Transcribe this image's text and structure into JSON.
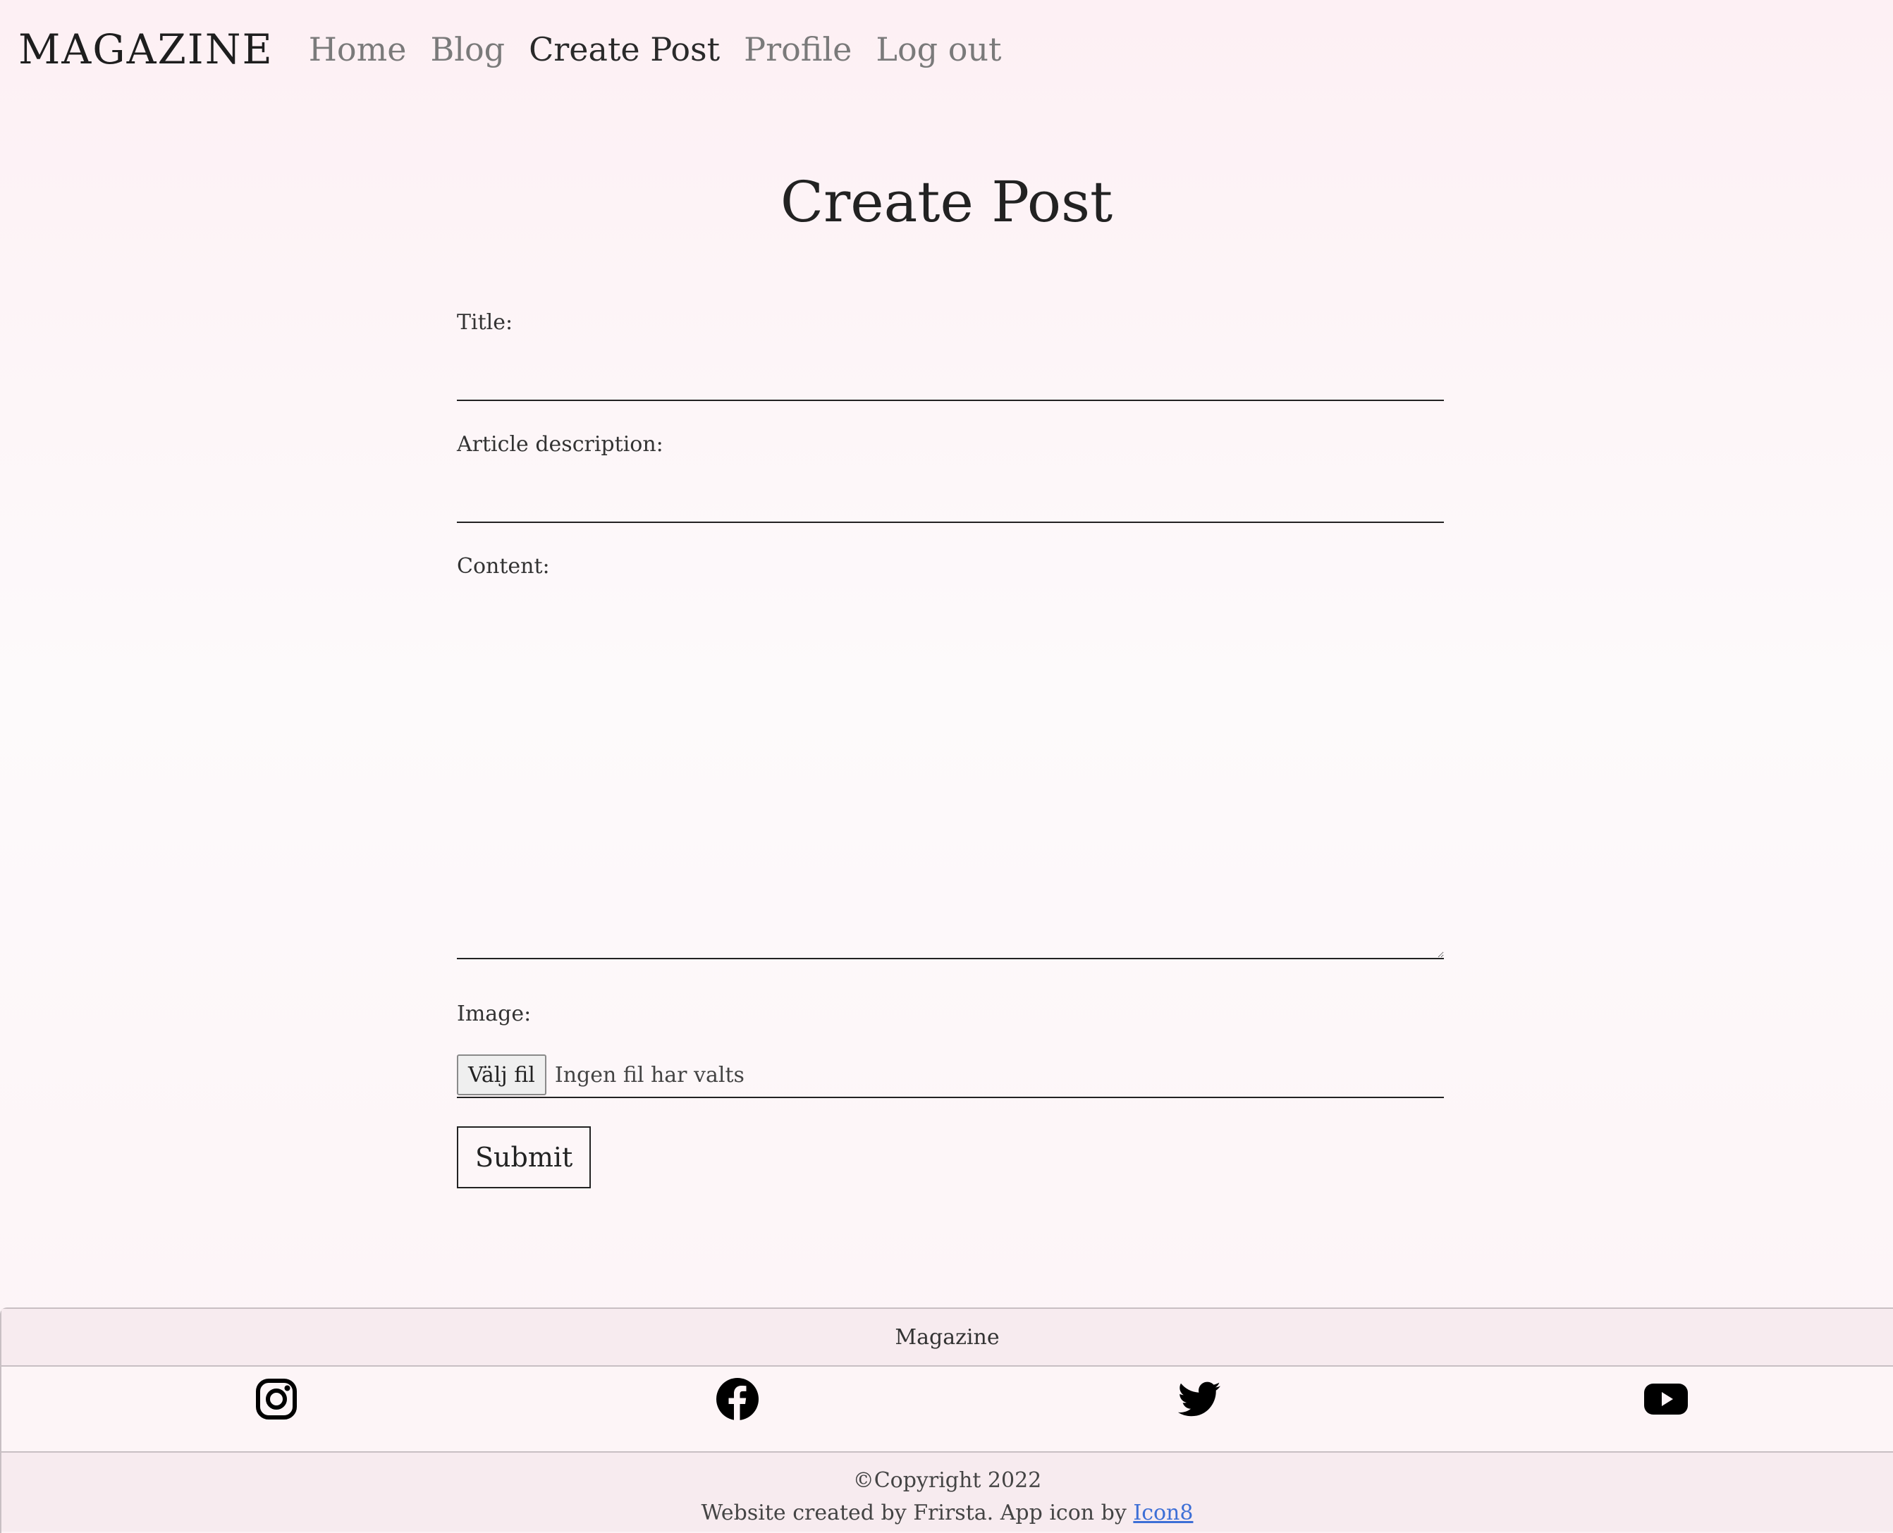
{
  "navbar": {
    "brand": "MAGAZINE",
    "links": [
      {
        "label": "Home",
        "active": false
      },
      {
        "label": "Blog",
        "active": false
      },
      {
        "label": "Create Post",
        "active": true
      },
      {
        "label": "Profile",
        "active": false
      },
      {
        "label": "Log out",
        "active": false
      }
    ]
  },
  "form": {
    "title": "Create Post",
    "title_label": "Title:",
    "title_value": "",
    "description_label": "Article description:",
    "description_value": "",
    "content_label": "Content:",
    "content_value": "",
    "image_label": "Image:",
    "file_button_label": "Välj fil",
    "file_status": "Ingen fil har valts",
    "submit_label": "Submit"
  },
  "footer": {
    "heading": "Magazine",
    "social": [
      {
        "name": "instagram-icon"
      },
      {
        "name": "facebook-icon"
      },
      {
        "name": "twitter-icon"
      },
      {
        "name": "youtube-icon"
      }
    ],
    "copyright": "©Copyright 2022",
    "credits_text": "Website created by Frirsta. App icon by ",
    "credits_link": "Icon8"
  },
  "colors": {
    "background_top": "#fdf0f4",
    "background_mid": "#fdfafb",
    "footer_band": "#f7ebef",
    "link_blue": "#3d6fd6",
    "nav_inactive": "#7a7a7a",
    "text_dark": "#222222"
  }
}
